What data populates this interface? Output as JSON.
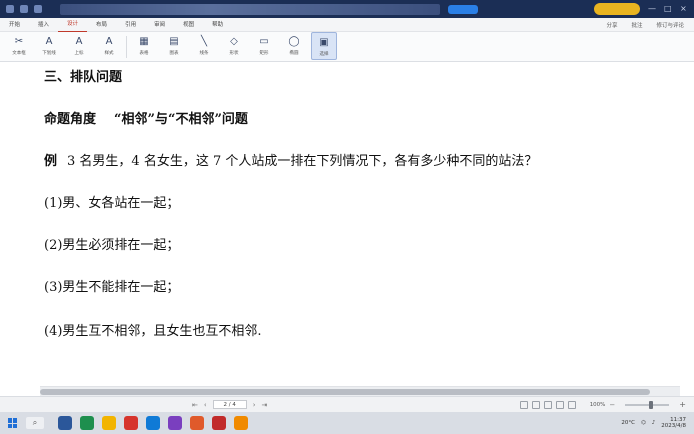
{
  "titlebar": {
    "title": "",
    "login_label": "",
    "controls": [
      "—",
      "□",
      "×"
    ]
  },
  "menu": {
    "items": [
      "开始",
      "插入",
      "设计",
      "布局",
      "引用",
      "审阅",
      "视图",
      "帮助"
    ],
    "active_index": 2,
    "right": [
      "分享",
      "批注",
      "修订与评论"
    ]
  },
  "ribbon": {
    "buttons": [
      {
        "icon": "✂",
        "label": "文本框"
      },
      {
        "icon": "A",
        "label": "下划线"
      },
      {
        "icon": "A",
        "label": "上标"
      },
      {
        "icon": "A",
        "label": "样式"
      },
      {
        "icon": "▦",
        "label": "表格"
      },
      {
        "icon": "▤",
        "label": "图表"
      },
      {
        "icon": "╲",
        "label": "线条"
      },
      {
        "icon": "◇",
        "label": "形状"
      },
      {
        "icon": "▭",
        "label": "矩形"
      },
      {
        "icon": "◯",
        "label": "椭圆"
      },
      {
        "icon": "▣",
        "label": "选择"
      }
    ]
  },
  "document": {
    "section_heading": "三、排队问题",
    "topic_label": "命题角度",
    "topic_text": "“相邻”与“不相邻”问题",
    "example_label": "例",
    "example_text": "3 名男生，4 名女生，这 7 个人站成一排在下列情况下，各有多少种不同的站法？",
    "items": [
      "(1)男、女各站在一起；",
      "(2)男生必须排在一起；",
      "(3)男生不能排在一起；",
      "(4)男生互不相邻，且女生也互不相邻."
    ]
  },
  "statusbar": {
    "page_indicator": "2 / 4",
    "zoom": "100%",
    "zoom_level_fraction": 0.6
  },
  "taskbar": {
    "weather": "20°C",
    "time": "11:37",
    "date": "2023/4/8",
    "icon_colors": [
      "#2b579a",
      "#1e8f4e",
      "#f2b400",
      "#d6342c",
      "#0f7ad6",
      "#7a3fbf",
      "#e05a2b",
      "#c12b2b",
      "#f08a00"
    ]
  }
}
